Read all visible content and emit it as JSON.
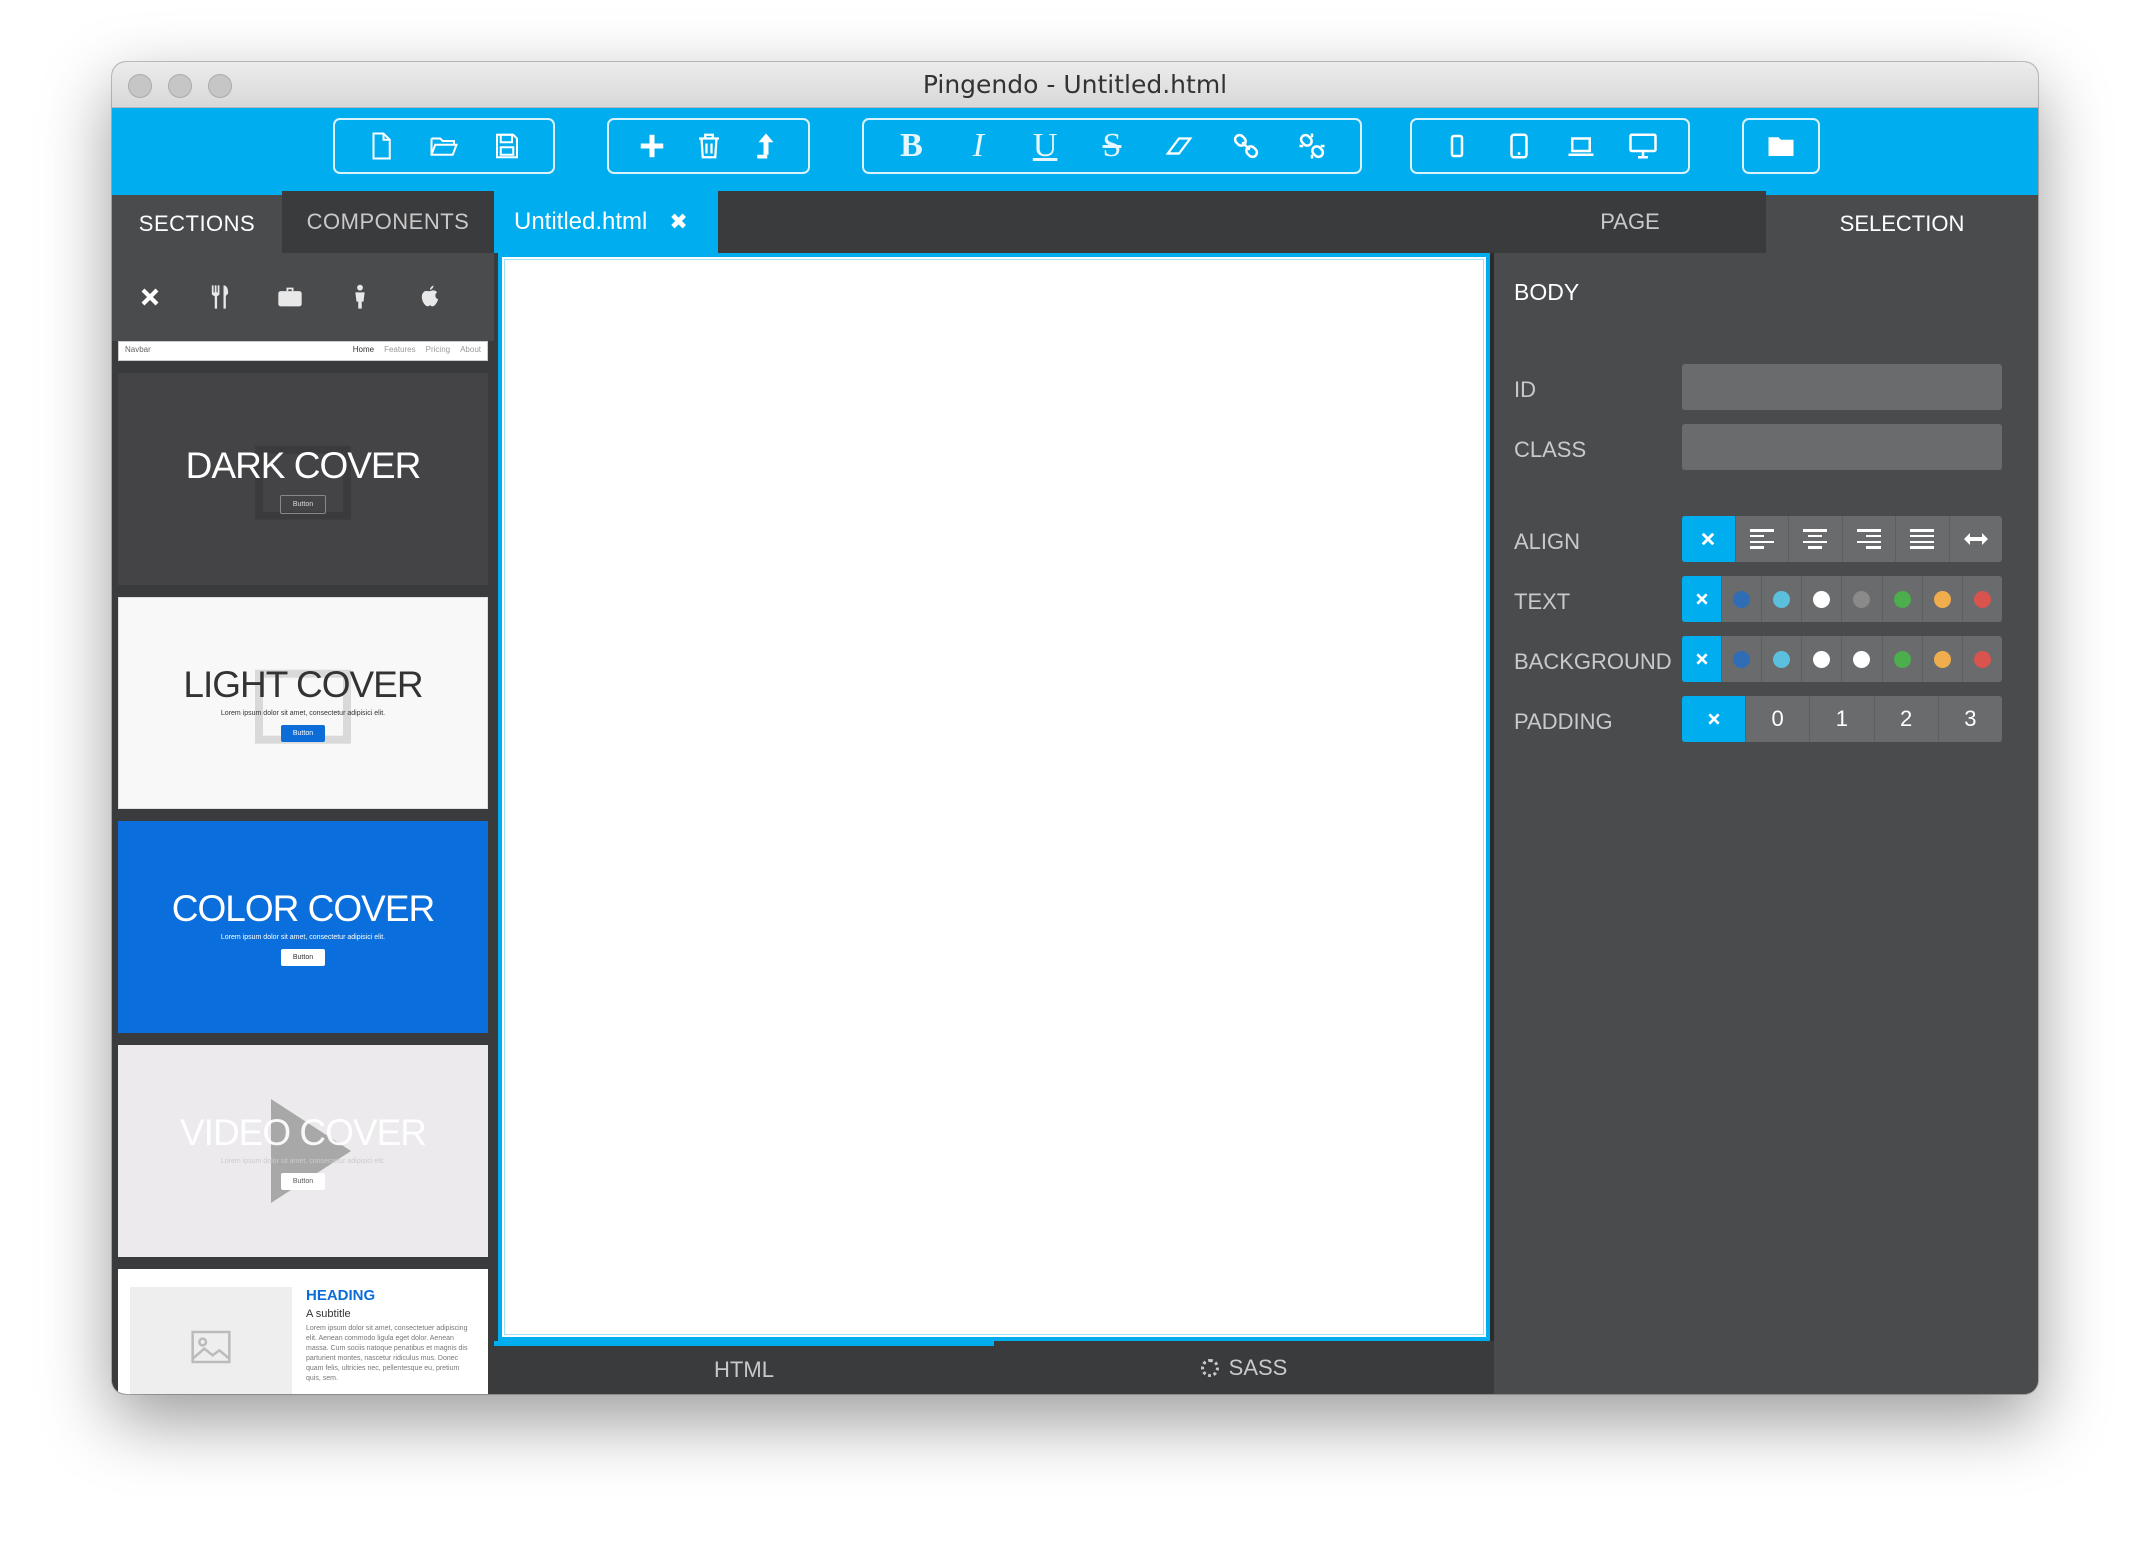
{
  "window": {
    "title": "Pingendo - Untitled.html"
  },
  "toolbar": {
    "file": [
      "new-file-icon",
      "open-folder-icon",
      "save-icon"
    ],
    "edit": [
      "plus-icon",
      "trash-icon",
      "move-up-icon"
    ],
    "format": {
      "bold": "B",
      "italic": "I",
      "underline": "U",
      "strike": "S"
    },
    "format_icons": [
      "eraser-icon",
      "link-icon",
      "unlink-icon"
    ],
    "devices": [
      "phone-icon",
      "tablet-icon",
      "laptop-icon",
      "desktop-icon"
    ],
    "project": "folder-icon"
  },
  "left_panel": {
    "tabs": [
      "SECTIONS",
      "COMPONENTS"
    ],
    "active_tab": "SECTIONS",
    "categories": [
      "close-icon",
      "cutlery-icon",
      "briefcase-icon",
      "person-icon",
      "apple-icon"
    ],
    "navbar_thumb": {
      "brand": "Navbar",
      "links": [
        "Home",
        "Features",
        "Pricing",
        "About"
      ]
    },
    "covers": [
      {
        "title": "DARK COVER",
        "subtitle": "",
        "button": "Button"
      },
      {
        "title": "LIGHT COVER",
        "subtitle": "Lorem ipsum dolor sit amet, consectetur adipisici elit.",
        "button": "Button"
      },
      {
        "title": "COLOR COVER",
        "subtitle": "Lorem ipsum dolor sit amet, consectetur adipisici elit.",
        "button": "Button"
      },
      {
        "title": "VIDEO COVER",
        "subtitle": "Lorem ipsum dolor sit amet, consectetur adipisici elit.",
        "button": "Button"
      }
    ],
    "feature": {
      "heading": "HEADING",
      "subtitle": "A subtitle",
      "text": "Lorem ipsum dolor sit amet, consectetuer adipiscing elit. Aenean commodo ligula eget dolor. Aenean massa. Cum sociis natoque penatibus et magnis dis parturient montes, nascetur ridiculus mus. Donec quam felis, ultricies nec, pellentesque eu, pretium quis, sem."
    }
  },
  "editor": {
    "tab_label": "Untitled.html",
    "bottom_tabs": [
      "HTML",
      "SASS"
    ],
    "active_bottom": "HTML"
  },
  "right_panel": {
    "tabs": [
      "PAGE",
      "SELECTION"
    ],
    "active_tab": "SELECTION",
    "selected_element": "BODY",
    "fields": {
      "id_label": "ID",
      "id_value": "",
      "class_label": "CLASS",
      "class_value": ""
    },
    "align_label": "ALIGN",
    "text_label": "TEXT",
    "background_label": "BACKGROUND",
    "padding_label": "PADDING",
    "padding_options": [
      "0",
      "1",
      "2",
      "3"
    ],
    "swatches_text": [
      "#2f6db6",
      "#5bc0de",
      "#ffffff",
      "#8a8a8a",
      "#4cae4c",
      "#f0ad4e",
      "#d9534f"
    ],
    "swatches_background": [
      "#2f6db6",
      "#5bc0de",
      "#ffffff",
      "#ffffff",
      "#4cae4c",
      "#f0ad4e",
      "#d9534f"
    ],
    "accent": "#00adee"
  }
}
